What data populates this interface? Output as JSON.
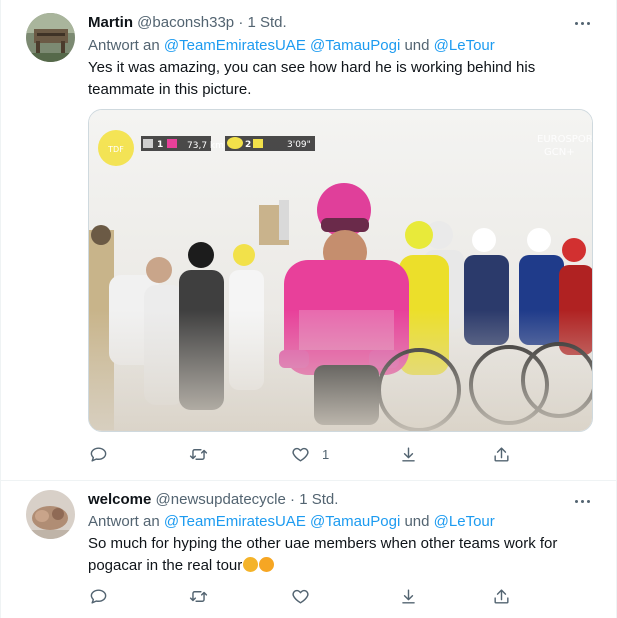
{
  "tweets": [
    {
      "name": "Martin",
      "handle": "@baconsh33p",
      "separator": "·",
      "time": "1 Std.",
      "reply_prefix": "Antwort an",
      "reply_to_1": "@TeamEmiratesUAE",
      "reply_to_2": "@TamauPogi",
      "reply_joiner": "und",
      "reply_to_3": "@LeTour",
      "text": "Yes it was amazing, you can see how hard he is working behind his teammate in this picture.",
      "media_overlay": {
        "race_distance": "73,7 km",
        "group_1_badge": "1",
        "group_2_badge": "2",
        "time_gap": "3'09\"",
        "broadcaster": "EUROSPORT",
        "broadcaster_sub": "GCN+"
      },
      "like_count": "1"
    },
    {
      "name": "welcome",
      "handle": "@newsupdatecycle",
      "separator": "·",
      "time": "1 Std.",
      "reply_prefix": "Antwort an",
      "reply_to_1": "@TeamEmiratesUAE",
      "reply_to_2": "@TamauPogi",
      "reply_joiner": "und",
      "reply_to_3": "@LeTour",
      "text": "So much for hyping the other uae members when other teams work for pogacar in the real tour",
      "like_count": ""
    }
  ],
  "colors": {
    "link": "#1d9bf0",
    "secondary_text": "#536471",
    "primary_text": "#0f1419",
    "divider": "#eff3f4",
    "jersey_pink": "#e8409a"
  },
  "icons": [
    "more-icon",
    "reply-icon",
    "retweet-icon",
    "like-icon",
    "share-icon",
    "upload-icon"
  ]
}
